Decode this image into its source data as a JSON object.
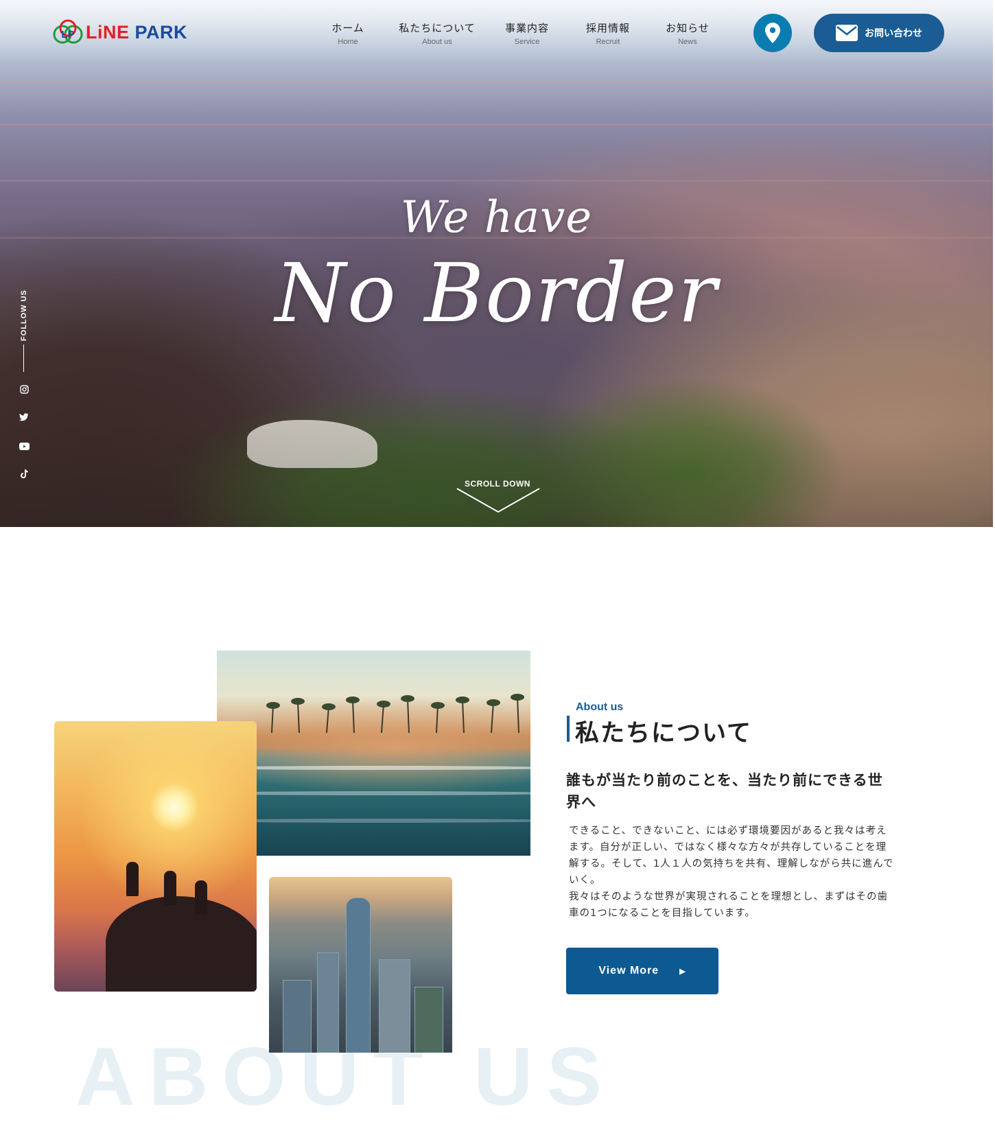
{
  "brand": {
    "name_part1": "LiNE",
    "name_part2": "PARK",
    "logo_initials": "LP",
    "colors": {
      "red": "#e31f26",
      "blue": "#1a4aa0",
      "green": "#1f9a3c"
    }
  },
  "nav": [
    {
      "jp": "ホーム",
      "en": "Home"
    },
    {
      "jp": "私たちについて",
      "en": "About us"
    },
    {
      "jp": "事業内容",
      "en": "Service"
    },
    {
      "jp": "採用情報",
      "en": "Recruit"
    },
    {
      "jp": "お知らせ",
      "en": "News"
    }
  ],
  "header": {
    "location_icon": "map-pin-icon",
    "contact_label": "お問い合わせ",
    "contact_icon": "envelope-icon",
    "accent": "#1a5c93",
    "pin_color": "#0a7db0"
  },
  "hero": {
    "line1": "We have",
    "line2": "No Border",
    "scroll_label": "SCROLL DOWN",
    "follow_label": "FOLLOW US",
    "social_icons": [
      "instagram-icon",
      "twitter-icon",
      "youtube-icon",
      "tiktok-icon"
    ]
  },
  "about": {
    "eyebrow": "About us",
    "title": "私たちについて",
    "lead": "誰もが当たり前のことを、当たり前にできる世界へ",
    "body_lines": [
      "できること、できないこと、には必ず環境要因があると我々は考えます。自分が正しい、ではなく様々な方々が共存していることを理解する。そして、1人１人の気持ちを共有、理解しながら共に進んでいく。",
      "我々はそのような世界が実現されることを理想とし、まずはその歯車の1つになることを目指しています。"
    ],
    "button_label": "View More",
    "button_color": "#0d5a92",
    "background_word": "ABOUT US"
  }
}
